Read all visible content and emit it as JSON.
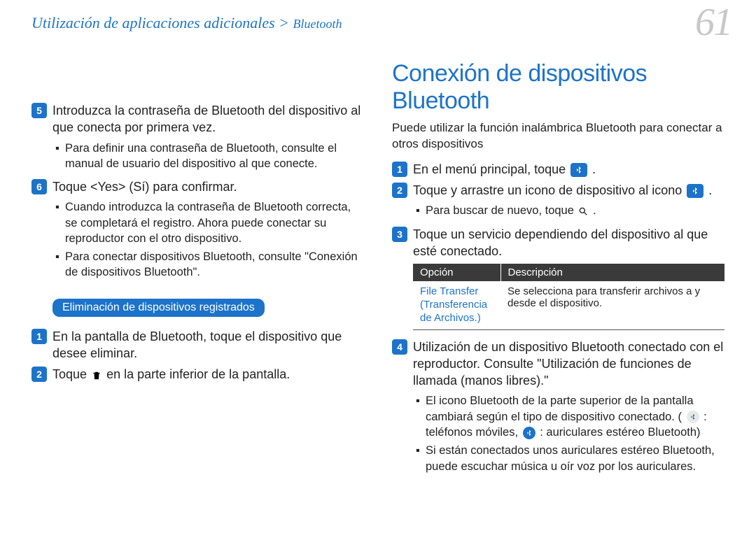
{
  "header": {
    "breadcrumb_main": "Utilización de aplicaciones adicionales > ",
    "breadcrumb_sub": "Bluetooth",
    "page_number": "61"
  },
  "left": {
    "step5": "Introduzca la contraseña de Bluetooth del dispositivo al que conecta por primera vez.",
    "step5_b1": "Para definir una contraseña de Bluetooth, consulte el manual de usuario del dispositivo al que conecte.",
    "step6": "Toque <Yes> (Sí) para confirmar.",
    "step6_b1": "Cuando introduzca la contraseña de Bluetooth correcta, se completará el registro. Ahora puede conectar su reproductor con el otro dispositivo.",
    "step6_b2": "Para conectar dispositivos Bluetooth, consulte \"Conexión de dispositivos Bluetooth\".",
    "section_pill": "Eliminación de dispositivos registrados",
    "d_step1": "En la pantalla de Bluetooth, toque el dispositivo que desee eliminar.",
    "d_step2_a": "Toque ",
    "d_step2_b": " en la parte inferior de la pantalla."
  },
  "right": {
    "title": "Conexión de dispositivos Bluetooth",
    "intro": "Puede utilizar la función inalámbrica Bluetooth para conectar a otros dispositivos",
    "step1_a": "En el menú principal, toque ",
    "step1_b": ".",
    "step2_a": "Toque y arrastre un icono de dispositivo al icono ",
    "step2_b": ".",
    "step2_bul_a": "Para buscar de nuevo, toque ",
    "step2_bul_b": ".",
    "step3": "Toque un servicio dependiendo del dispositivo al que esté conectado.",
    "table": {
      "h1": "Opción",
      "h2": "Descripción",
      "r1c1": "File Transfer (Transferencia de Archivos.)",
      "r1c2": "Se selecciona para transferir archivos a y desde el dispositivo."
    },
    "step4": "Utilización de un dispositivo Bluetooth conectado con el reproductor. Consulte \"Utilización de funciones de llamada (manos libres).\"",
    "step4_b1_a": "El icono Bluetooth de la parte superior de la pantalla cambiará según el tipo de dispositivo conectado. (",
    "step4_b1_b": ": teléfonos móviles, ",
    "step4_b1_c": ": auriculares estéreo Bluetooth)",
    "step4_b2": "Si están conectados unos auriculares estéreo Bluetooth, puede escuchar música u oír voz por los auriculares."
  }
}
